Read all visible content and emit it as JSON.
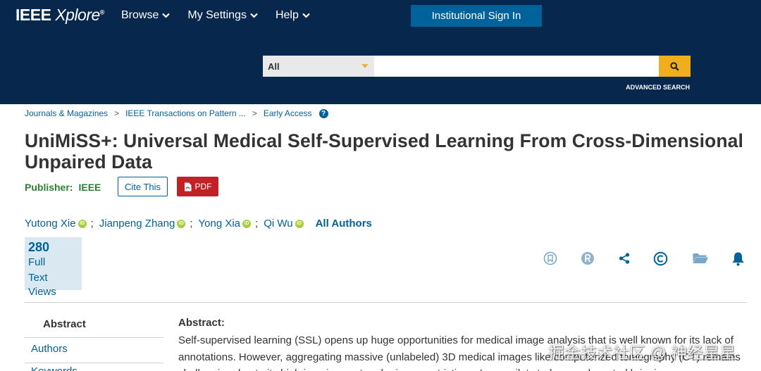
{
  "header": {
    "logo_main": "IEEE",
    "logo_italic": "Xplore",
    "logo_reg": "®",
    "nav": [
      {
        "label": "Browse"
      },
      {
        "label": "My Settings"
      },
      {
        "label": "Help"
      }
    ],
    "signin_label": "Institutional Sign In",
    "search": {
      "scope_value": "All",
      "placeholder": "",
      "advanced_label": "ADVANCED SEARCH"
    },
    "colors": {
      "header_bg": "#002855",
      "signin_bg": "#00629b",
      "search_btn": "#f0ad1e"
    }
  },
  "breadcrumb": {
    "items": [
      "Journals & Magazines",
      "IEEE Transactions on Pattern ...",
      "Early Access"
    ],
    "separator": ">",
    "help_icon": "?"
  },
  "article": {
    "title": "UniMiSS+: Universal Medical Self-Supervised Learning From Cross-Dimensional Unpaired Data",
    "publisher_label": "Publisher:",
    "publisher_value": "IEEE",
    "cite_label": "Cite This",
    "pdf_label": "PDF",
    "authors": [
      {
        "name": "Yutong Xie"
      },
      {
        "name": "Jianpeng Zhang"
      },
      {
        "name": "Yong Xia"
      },
      {
        "name": "Qi Wu"
      }
    ],
    "author_separator": ";",
    "all_authors_label": "All Authors",
    "orcid_glyph": "iD"
  },
  "views": {
    "count": "280",
    "label_line1": "Full",
    "label_line2": "Text Views"
  },
  "actions": [
    {
      "icon": "bookmark-icon"
    },
    {
      "icon": "rights-icon"
    },
    {
      "icon": "share-icon"
    },
    {
      "icon": "copyright-icon"
    },
    {
      "icon": "folder-icon"
    },
    {
      "icon": "bell-icon"
    }
  ],
  "sidebar": {
    "items": [
      {
        "label": "Abstract"
      },
      {
        "label": "Authors"
      },
      {
        "label": "Keywords"
      }
    ]
  },
  "abstract": {
    "heading": "Abstract:",
    "text": "Self-supervised learning (SSL) opens up huge opportunities for medical image analysis that is well known for its lack of annotations. However, aggregating massive (unlabeled) 3D medical images like computerized tomography (CT) remains challenging due to its high imaging cost and privacy restrictions. In our pilot study, we advocated bringing a"
  },
  "watermark": "掘金技术社区 @ 神经星星"
}
